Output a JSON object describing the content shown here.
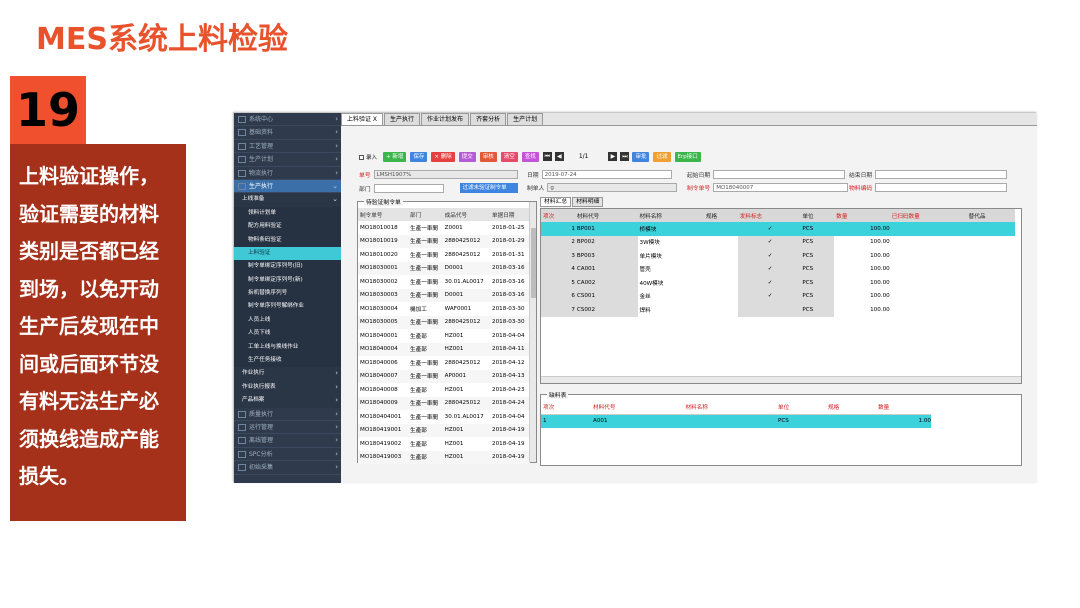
{
  "slide": {
    "title": "MES系统上料检验",
    "number": "19",
    "description": "上料验证操作，验证需要的材料类别是否都已经到场，以免开动生产后发现在中间或后面环节没有料无法生产必须换线造成产能损失。"
  },
  "sidebar": {
    "top_items": [
      "系统中心",
      "基础资料",
      "工艺管理",
      "生产计划",
      "物流执行"
    ],
    "open_item": "生产执行",
    "group_header": "上线准备",
    "sub_items": [
      "领料计划单",
      "配方用料验证",
      "物料条码验证",
      "上料验证",
      "制令单绑定序列号(旧)",
      "制令单绑定序列号(新)",
      "拆机替换序列号",
      "制令单序列号解绑作业",
      "人员上线",
      "人员下线",
      "工单上线与换线作业",
      "生产任务接收"
    ],
    "active_sub": "上料验证",
    "more_sub": [
      "作业执行",
      "作业执行报表",
      "产品档案"
    ],
    "bottom_items": [
      "质量执行",
      "运行管理",
      "离线管理",
      "SPC分析",
      "初始采集"
    ]
  },
  "tabs": [
    {
      "label": "上料验证 X",
      "active": true
    },
    {
      "label": "生产执行",
      "active": false
    },
    {
      "label": "作业计划发布",
      "active": false
    },
    {
      "label": "齐套分析",
      "active": false
    },
    {
      "label": "生产计划",
      "active": false
    }
  ],
  "toolbar": {
    "checkbox_label": "录入",
    "buttons": [
      {
        "label": "+ 新增",
        "color": "#3cb54a"
      },
      {
        "label": "保存",
        "color": "#3d85e0"
      },
      {
        "label": "× 删除",
        "color": "#e64040"
      },
      {
        "label": "提交",
        "color": "#b65bd6"
      },
      {
        "label": "审核",
        "color": "#e05a3a"
      },
      {
        "label": "清空",
        "color": "#e84a6a"
      },
      {
        "label": "查找",
        "color": "#c255d6"
      }
    ],
    "page": "1/1",
    "buttons2": [
      {
        "label": "审批",
        "color": "#3d85e0"
      },
      {
        "label": "过滤",
        "color": "#f0a030"
      },
      {
        "label": "Erp接口",
        "color": "#3cb54a"
      }
    ]
  },
  "form": {
    "order_no_label": "单号",
    "order_no": "LMSH1907%",
    "date_label": "日期",
    "date": "2019-07-24",
    "start_date_label": "起始日期",
    "end_date_label": "结束日期",
    "dept_label": "部门",
    "filter_btn": "过滤未验证制令单",
    "creator_label": "制单人",
    "creator": "g",
    "mo_label": "制令单号",
    "mo": "MO18040007",
    "material_code_label": "物料编码"
  },
  "left_group": {
    "title": "待验证制令单",
    "columns": [
      "制令单号",
      "部门",
      "成品代号",
      "单据日期"
    ],
    "rows": [
      [
        "MO18010018",
        "生產一車間",
        "Z0001",
        "2018-01-25"
      ],
      [
        "MO18010019",
        "生產一車間",
        "2880425012",
        "2018-01-29"
      ],
      [
        "MO18010020",
        "生產一車間",
        "2880425012",
        "2018-01-31"
      ],
      [
        "MO18030001",
        "生產一車間",
        "D0001",
        "2018-03-16"
      ],
      [
        "MO18030002",
        "生產一車間",
        "30.01.AL0017",
        "2018-03-16"
      ],
      [
        "MO18030003",
        "生產一車間",
        "D0001",
        "2018-03-16"
      ],
      [
        "MO18030004",
        "機加工",
        "WAF0001",
        "2018-03-30"
      ],
      [
        "MO18030005",
        "生產一車間",
        "2880425012",
        "2018-03-30"
      ],
      [
        "MO18040001",
        "生產部",
        "HZ001",
        "2018-04-04"
      ],
      [
        "MO18040004",
        "生產部",
        "HZ001",
        "2018-04-11"
      ],
      [
        "MO18040006",
        "生產一車間",
        "2880425012",
        "2018-04-12"
      ],
      [
        "MO18040007",
        "生產一車間",
        "AP0001",
        "2018-04-13"
      ],
      [
        "MO18040008",
        "生產部",
        "HZ001",
        "2018-04-23"
      ],
      [
        "MO18040009",
        "生產一車間",
        "2880425012",
        "2018-04-24"
      ],
      [
        "MO180404001",
        "生產一車間",
        "30.01.AL0017",
        "2018-04-04"
      ],
      [
        "MO180419001",
        "生產部",
        "HZ001",
        "2018-04-19"
      ],
      [
        "MO180419002",
        "生產部",
        "HZ001",
        "2018-04-19"
      ],
      [
        "MO180419003",
        "生產部",
        "HZ001",
        "2018-04-19"
      ]
    ]
  },
  "right_tabs": [
    "材料汇总",
    "材料明细"
  ],
  "right_table": {
    "columns": [
      "项次",
      "材料代号",
      "材料名称",
      "规格",
      "发料标志",
      "单位",
      "数量",
      "已扫码数量",
      "替代品"
    ],
    "rows": [
      [
        "1",
        "BP001",
        "桥模块",
        "",
        "✓",
        "PCS",
        "100.00",
        "",
        ""
      ],
      [
        "2",
        "BP002",
        "3W模块",
        "",
        "✓",
        "PCS",
        "100.00",
        "",
        ""
      ],
      [
        "3",
        "BP003",
        "单片模块",
        "",
        "✓",
        "PCS",
        "100.00",
        "",
        ""
      ],
      [
        "4",
        "CA001",
        "管壳",
        "",
        "✓",
        "PCS",
        "100.00",
        "",
        ""
      ],
      [
        "5",
        "CA002",
        "40W模块",
        "",
        "✓",
        "PCS",
        "100.00",
        "",
        ""
      ],
      [
        "6",
        "CS001",
        "金丝",
        "",
        "✓",
        "PCS",
        "100.00",
        "",
        ""
      ],
      [
        "7",
        "CS002",
        "焊料",
        "",
        "",
        "PCS",
        "100.00",
        "",
        ""
      ]
    ]
  },
  "bottom_group": {
    "title": "缺料表",
    "columns": [
      "项次",
      "材料代号",
      "材料名称",
      "单位",
      "规格",
      "数量"
    ],
    "rows": [
      [
        "1",
        "A001",
        "",
        "PCS",
        "",
        "1.00"
      ]
    ]
  }
}
